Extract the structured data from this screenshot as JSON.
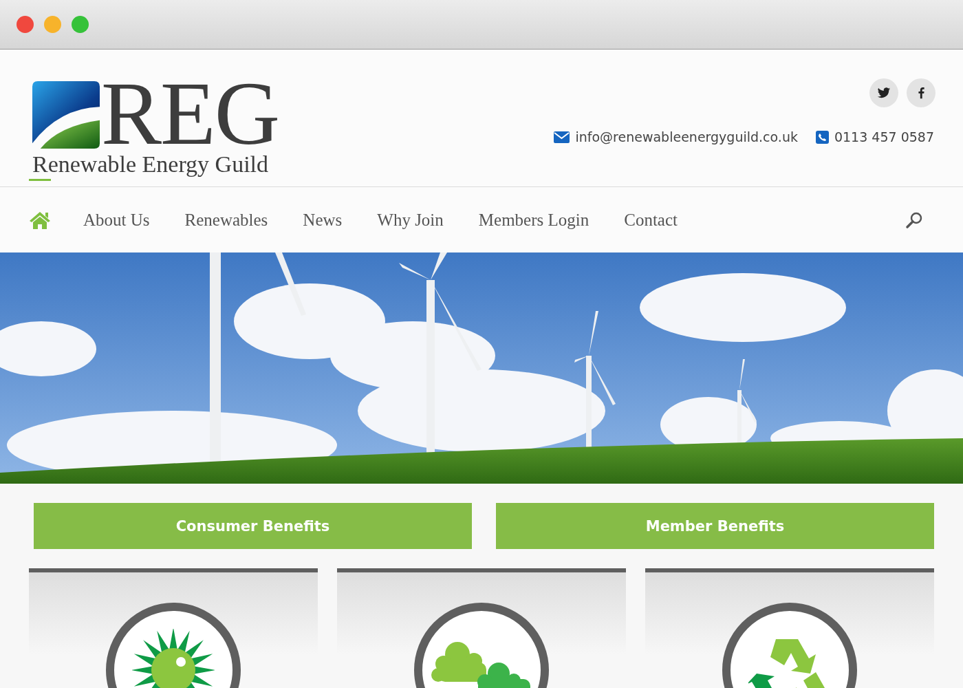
{
  "logo": {
    "mark": "REG",
    "tagline": "Renewable Energy Guild"
  },
  "social": [
    {
      "kind": "twitter"
    },
    {
      "kind": "facebook"
    }
  ],
  "contact": [
    {
      "kind": "email",
      "text": "info@renewableenergyguild.co.uk"
    },
    {
      "kind": "phone",
      "text": "0113 457 0587"
    }
  ],
  "nav": [
    {
      "kind": "home",
      "selected": true
    },
    {
      "kind": "link",
      "label": "About Us",
      "selected": false
    },
    {
      "kind": "link",
      "label": "Renewables",
      "selected": false
    },
    {
      "kind": "link",
      "label": "News",
      "selected": false
    },
    {
      "kind": "link",
      "label": "Why Join",
      "selected": false
    },
    {
      "kind": "link",
      "label": "Members Login",
      "selected": false
    },
    {
      "kind": "link",
      "label": "Contact",
      "selected": false
    }
  ],
  "benefit_buttons": [
    "Consumer Benefits",
    "Member Benefits"
  ],
  "cards": [
    {
      "kind": "sun"
    },
    {
      "kind": "clouds"
    },
    {
      "kind": "recycle"
    }
  ]
}
